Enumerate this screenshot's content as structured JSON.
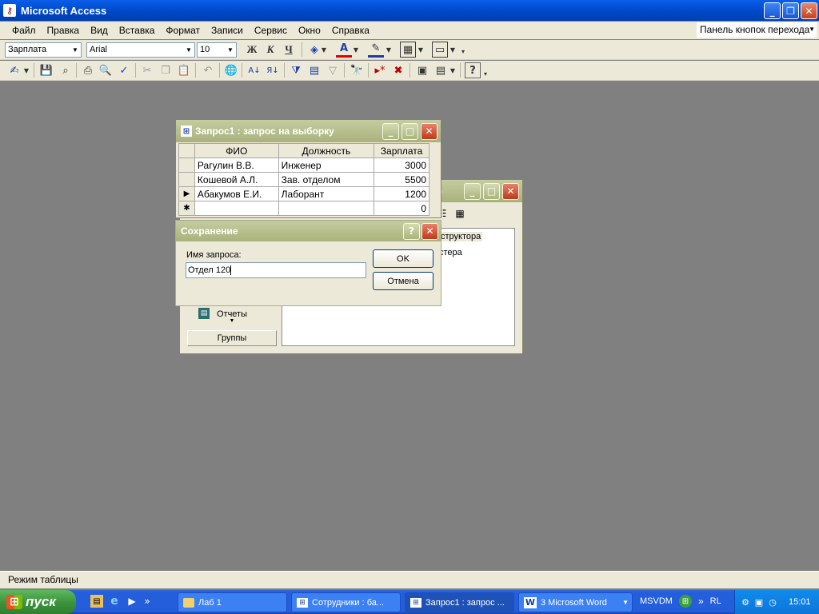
{
  "app": {
    "title": "Microsoft Access"
  },
  "menu": [
    "Файл",
    "Правка",
    "Вид",
    "Вставка",
    "Формат",
    "Записи",
    "Сервис",
    "Окно",
    "Справка"
  ],
  "nav_toolbar_label": "Панель кнопок перехода",
  "format_toolbar": {
    "object": "Зарплата",
    "font": "Arial",
    "size": "10",
    "bold": "Ж",
    "italic": "К",
    "underline": "Ч"
  },
  "query_window": {
    "title": "Запрос1 : запрос на выборку",
    "columns": [
      "ФИО",
      "Должность",
      "Зарплата"
    ],
    "rows": [
      {
        "fio": "Рагулин В.В.",
        "position": "Инженер",
        "salary": "3000"
      },
      {
        "fio": "Кошевой А.Л.",
        "position": "Зав. отделом",
        "salary": "5500"
      },
      {
        "fio": "Абакумов Е.И.",
        "position": "Лаборант",
        "salary": "1200"
      }
    ],
    "new_row_salary": "0"
  },
  "db_window": {
    "items": [
      "структора",
      "стера"
    ],
    "sidebar_reports": "Отчеты",
    "sidebar_groups": "Группы"
  },
  "save_dialog": {
    "title": "Сохранение",
    "label": "Имя запроса:",
    "value": "Отдел 120",
    "ok": "OK",
    "cancel": "Отмена"
  },
  "status_bar": {
    "text": "Режим таблицы"
  },
  "taskbar": {
    "start": "пуск",
    "tasks": [
      "Лаб 1",
      "Сотрудники : ба...",
      "Запрос1 : запрос ...",
      "3 Microsoft Word"
    ],
    "tray_items": [
      "MSVDM",
      "RL"
    ],
    "clock": "15:01"
  },
  "colors": {
    "desktop": "#808080",
    "xp_blue": "#0a5ee8",
    "olive_title": "#a9b27c"
  }
}
